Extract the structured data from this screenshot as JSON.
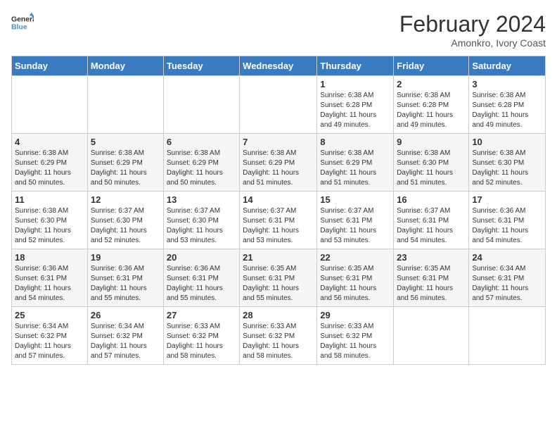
{
  "header": {
    "logo_line1": "General",
    "logo_line2": "Blue",
    "title": "February 2024",
    "subtitle": "Amonkro, Ivory Coast"
  },
  "days_of_week": [
    "Sunday",
    "Monday",
    "Tuesday",
    "Wednesday",
    "Thursday",
    "Friday",
    "Saturday"
  ],
  "weeks": [
    [
      {
        "day": "",
        "info": ""
      },
      {
        "day": "",
        "info": ""
      },
      {
        "day": "",
        "info": ""
      },
      {
        "day": "",
        "info": ""
      },
      {
        "day": "1",
        "info": "Sunrise: 6:38 AM\nSunset: 6:28 PM\nDaylight: 11 hours\nand 49 minutes."
      },
      {
        "day": "2",
        "info": "Sunrise: 6:38 AM\nSunset: 6:28 PM\nDaylight: 11 hours\nand 49 minutes."
      },
      {
        "day": "3",
        "info": "Sunrise: 6:38 AM\nSunset: 6:28 PM\nDaylight: 11 hours\nand 49 minutes."
      }
    ],
    [
      {
        "day": "4",
        "info": "Sunrise: 6:38 AM\nSunset: 6:29 PM\nDaylight: 11 hours\nand 50 minutes."
      },
      {
        "day": "5",
        "info": "Sunrise: 6:38 AM\nSunset: 6:29 PM\nDaylight: 11 hours\nand 50 minutes."
      },
      {
        "day": "6",
        "info": "Sunrise: 6:38 AM\nSunset: 6:29 PM\nDaylight: 11 hours\nand 50 minutes."
      },
      {
        "day": "7",
        "info": "Sunrise: 6:38 AM\nSunset: 6:29 PM\nDaylight: 11 hours\nand 51 minutes."
      },
      {
        "day": "8",
        "info": "Sunrise: 6:38 AM\nSunset: 6:29 PM\nDaylight: 11 hours\nand 51 minutes."
      },
      {
        "day": "9",
        "info": "Sunrise: 6:38 AM\nSunset: 6:30 PM\nDaylight: 11 hours\nand 51 minutes."
      },
      {
        "day": "10",
        "info": "Sunrise: 6:38 AM\nSunset: 6:30 PM\nDaylight: 11 hours\nand 52 minutes."
      }
    ],
    [
      {
        "day": "11",
        "info": "Sunrise: 6:38 AM\nSunset: 6:30 PM\nDaylight: 11 hours\nand 52 minutes."
      },
      {
        "day": "12",
        "info": "Sunrise: 6:37 AM\nSunset: 6:30 PM\nDaylight: 11 hours\nand 52 minutes."
      },
      {
        "day": "13",
        "info": "Sunrise: 6:37 AM\nSunset: 6:30 PM\nDaylight: 11 hours\nand 53 minutes."
      },
      {
        "day": "14",
        "info": "Sunrise: 6:37 AM\nSunset: 6:31 PM\nDaylight: 11 hours\nand 53 minutes."
      },
      {
        "day": "15",
        "info": "Sunrise: 6:37 AM\nSunset: 6:31 PM\nDaylight: 11 hours\nand 53 minutes."
      },
      {
        "day": "16",
        "info": "Sunrise: 6:37 AM\nSunset: 6:31 PM\nDaylight: 11 hours\nand 54 minutes."
      },
      {
        "day": "17",
        "info": "Sunrise: 6:36 AM\nSunset: 6:31 PM\nDaylight: 11 hours\nand 54 minutes."
      }
    ],
    [
      {
        "day": "18",
        "info": "Sunrise: 6:36 AM\nSunset: 6:31 PM\nDaylight: 11 hours\nand 54 minutes."
      },
      {
        "day": "19",
        "info": "Sunrise: 6:36 AM\nSunset: 6:31 PM\nDaylight: 11 hours\nand 55 minutes."
      },
      {
        "day": "20",
        "info": "Sunrise: 6:36 AM\nSunset: 6:31 PM\nDaylight: 11 hours\nand 55 minutes."
      },
      {
        "day": "21",
        "info": "Sunrise: 6:35 AM\nSunset: 6:31 PM\nDaylight: 11 hours\nand 55 minutes."
      },
      {
        "day": "22",
        "info": "Sunrise: 6:35 AM\nSunset: 6:31 PM\nDaylight: 11 hours\nand 56 minutes."
      },
      {
        "day": "23",
        "info": "Sunrise: 6:35 AM\nSunset: 6:31 PM\nDaylight: 11 hours\nand 56 minutes."
      },
      {
        "day": "24",
        "info": "Sunrise: 6:34 AM\nSunset: 6:31 PM\nDaylight: 11 hours\nand 57 minutes."
      }
    ],
    [
      {
        "day": "25",
        "info": "Sunrise: 6:34 AM\nSunset: 6:32 PM\nDaylight: 11 hours\nand 57 minutes."
      },
      {
        "day": "26",
        "info": "Sunrise: 6:34 AM\nSunset: 6:32 PM\nDaylight: 11 hours\nand 57 minutes."
      },
      {
        "day": "27",
        "info": "Sunrise: 6:33 AM\nSunset: 6:32 PM\nDaylight: 11 hours\nand 58 minutes."
      },
      {
        "day": "28",
        "info": "Sunrise: 6:33 AM\nSunset: 6:32 PM\nDaylight: 11 hours\nand 58 minutes."
      },
      {
        "day": "29",
        "info": "Sunrise: 6:33 AM\nSunset: 6:32 PM\nDaylight: 11 hours\nand 58 minutes."
      },
      {
        "day": "",
        "info": ""
      },
      {
        "day": "",
        "info": ""
      }
    ]
  ]
}
